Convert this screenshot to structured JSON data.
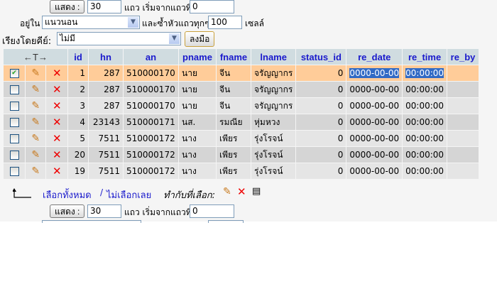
{
  "top_nav": {
    "show_label": "แสดง :",
    "rows": "30",
    "rows_label": "แถว เริ่มจากแถวที่",
    "start": "0",
    "in_label": "อยู่ใน",
    "mode": "แนวนอน",
    "repeat_label": "และซ้ำหัวแถวทุกๆ",
    "repeat": "100",
    "cells_label": "เซลล์"
  },
  "sort": {
    "label": "เรียงโดยคีย์:",
    "value": "ไม่มี",
    "go_label": "ลงมือ"
  },
  "table": {
    "arrows": "←T→",
    "columns": [
      "id",
      "hn",
      "an",
      "pname",
      "fname",
      "lname",
      "status_id",
      "re_date",
      "re_time",
      "re_by"
    ],
    "rows": [
      {
        "id": "1",
        "hn": "287",
        "an": "510000170",
        "pname": "นาย",
        "fname": "จีน",
        "lname": "จรัญญากร",
        "status_id": "0",
        "re_date": "0000-00-00",
        "re_time": "00:00:00",
        "re_by": ""
      },
      {
        "id": "2",
        "hn": "287",
        "an": "510000170",
        "pname": "นาย",
        "fname": "จีน",
        "lname": "จรัญญากร",
        "status_id": "0",
        "re_date": "0000-00-00",
        "re_time": "00:00:00",
        "re_by": ""
      },
      {
        "id": "3",
        "hn": "287",
        "an": "510000170",
        "pname": "นาย",
        "fname": "จีน",
        "lname": "จรัญญากร",
        "status_id": "0",
        "re_date": "0000-00-00",
        "re_time": "00:00:00",
        "re_by": ""
      },
      {
        "id": "4",
        "hn": "23143",
        "an": "510000171",
        "pname": "นส.",
        "fname": "รมณีย",
        "lname": "หุ่มหวง",
        "status_id": "0",
        "re_date": "0000-00-00",
        "re_time": "00:00:00",
        "re_by": ""
      },
      {
        "id": "5",
        "hn": "7511",
        "an": "510000172",
        "pname": "นาง",
        "fname": "เพียร",
        "lname": "รุ่งโรจน์",
        "status_id": "0",
        "re_date": "0000-00-00",
        "re_time": "00:00:00",
        "re_by": ""
      },
      {
        "id": "20",
        "hn": "7511",
        "an": "510000172",
        "pname": "นาง",
        "fname": "เพียร",
        "lname": "รุ่งโรจน์",
        "status_id": "0",
        "re_date": "0000-00-00",
        "re_time": "00:00:00",
        "re_by": ""
      },
      {
        "id": "19",
        "hn": "7511",
        "an": "510000172",
        "pname": "นาง",
        "fname": "เพียร",
        "lname": "รุ่งโรจน์",
        "status_id": "0",
        "re_date": "0000-00-00",
        "re_time": "00:00:00",
        "re_by": ""
      }
    ]
  },
  "footer": {
    "check_all": "เลือกทั้งหมด",
    "sep": "/",
    "uncheck_all": "ไม่เลือกเลย",
    "with_selected": "ทำกับที่เลือก:"
  },
  "bottom_nav": {
    "show_label": "แสดง :",
    "rows": "30",
    "rows_label": "แถว เริ่มจากแถวที่",
    "start": "0"
  }
}
